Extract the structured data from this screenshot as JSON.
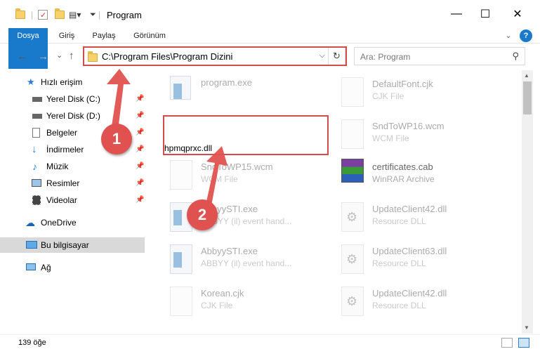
{
  "window": {
    "title": "Program",
    "min": "—",
    "max": "☐",
    "close": "✕"
  },
  "ribbon": {
    "tabs": [
      "Dosya",
      "Giriş",
      "Paylaş",
      "Görünüm"
    ],
    "expand": "⌄",
    "help": "?"
  },
  "address": {
    "path": "C:\\Program Files\\Program Dizini",
    "chevron": "⌵",
    "refresh": "↻"
  },
  "search": {
    "placeholder": "Ara: Program",
    "icon": "search-icon"
  },
  "nav": {
    "back": "←",
    "forward": "→",
    "recent": "⌄",
    "up": "↑",
    "items": [
      {
        "label": "Hızlı erişim",
        "icon": "star-icon"
      },
      {
        "label": "Yerel Disk (C:)",
        "icon": "drive-icon",
        "pinned": true
      },
      {
        "label": "Yerel Disk (D:)",
        "icon": "drive-icon",
        "pinned": true
      },
      {
        "label": "Belgeler",
        "icon": "document-icon",
        "pinned": true
      },
      {
        "label": "İndirmeler",
        "icon": "download-icon",
        "pinned": true
      },
      {
        "label": "Müzik",
        "icon": "music-icon",
        "pinned": true
      },
      {
        "label": "Resimler",
        "icon": "pictures-icon",
        "pinned": true
      },
      {
        "label": "Videolar",
        "icon": "video-icon",
        "pinned": true
      },
      {
        "label": "OneDrive",
        "icon": "cloud-icon"
      },
      {
        "label": "Bu bilgisayar",
        "icon": "computer-icon"
      },
      {
        "label": "Ağ",
        "icon": "network-icon"
      }
    ],
    "pin": "📌"
  },
  "files": [
    {
      "name": "program.exe",
      "type": ""
    },
    {
      "name": "DefaultFont.cjk",
      "type": "CJK File"
    },
    {
      "name": "hpmqprxc.dll",
      "type": ""
    },
    {
      "name": "SndToWP16.wcm",
      "type": "WCM File"
    },
    {
      "name": "SndToWP15.wcm",
      "type": "WCM File"
    },
    {
      "name": "certificates.cab",
      "type": "WinRAR Archive"
    },
    {
      "name": "AbbyySTI.exe",
      "type": "ABBYY (il) event hand..."
    },
    {
      "name": "UpdateClient42.dll",
      "type": "Resource DLL"
    },
    {
      "name": "AbbyySTI.exe",
      "type": "ABBYY (il) event hand..."
    },
    {
      "name": "UpdateClient63.dll",
      "type": "Resource DLL"
    },
    {
      "name": "Korean.cjk",
      "type": "CJK File"
    },
    {
      "name": "UpdateClient42.dll",
      "type": "Resource DLL"
    }
  ],
  "callouts": [
    "1",
    "2"
  ],
  "status": {
    "count": "139 öğe"
  },
  "colors": {
    "accent": "#1979ca",
    "highlight": "#d64a4a",
    "badge": "#e0524f"
  }
}
